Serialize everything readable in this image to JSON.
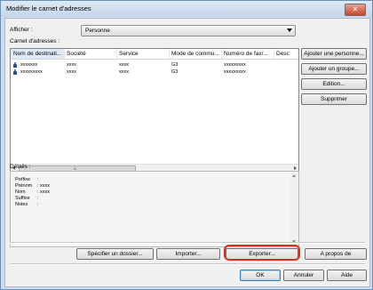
{
  "window": {
    "title": "Modifier le carnet d'adresses",
    "close_glyph": "✕"
  },
  "display": {
    "label": "Afficher :",
    "value": "Personne"
  },
  "address_book": {
    "label": "Carnet d'adresses :",
    "columns": [
      "Nom de destinati...",
      "Société",
      "Service",
      "Mode de commu...",
      "Numéro de fax/...",
      "Desc"
    ],
    "rows": [
      [
        "xxxxxxx",
        "xxxx",
        "xxxx",
        "G3",
        "xxxxxxxxx",
        ""
      ],
      [
        "xxxxxxxxx",
        "xxxx",
        "xxxx",
        "G3",
        "xxxxxxxxx",
        ""
      ]
    ],
    "scroll_grip": "III"
  },
  "side_buttons": {
    "add_person": "Ajouter une personne...",
    "add_group": "Ajouter un groupe...",
    "edit": "Edition...",
    "delete": "Supprimer"
  },
  "details": {
    "label": "Détails :",
    "fields": [
      {
        "name": "Préfixe",
        "value": ":"
      },
      {
        "name": "Prénom",
        "value": ": xxxx"
      },
      {
        "name": "Nom",
        "value": ": xxxx"
      },
      {
        "name": "Suffixe",
        "value": ":"
      },
      {
        "name": "Notes",
        "value": ":"
      }
    ]
  },
  "bottom_buttons": {
    "specify_folder": "Spécifier un dossier...",
    "import": "Importer...",
    "export": "Exporter...",
    "about": "A propos de"
  },
  "dialog_buttons": {
    "ok": "OK",
    "cancel": "Annuler",
    "help": "Aide"
  },
  "colors": {
    "highlight": "#e02a1b"
  }
}
